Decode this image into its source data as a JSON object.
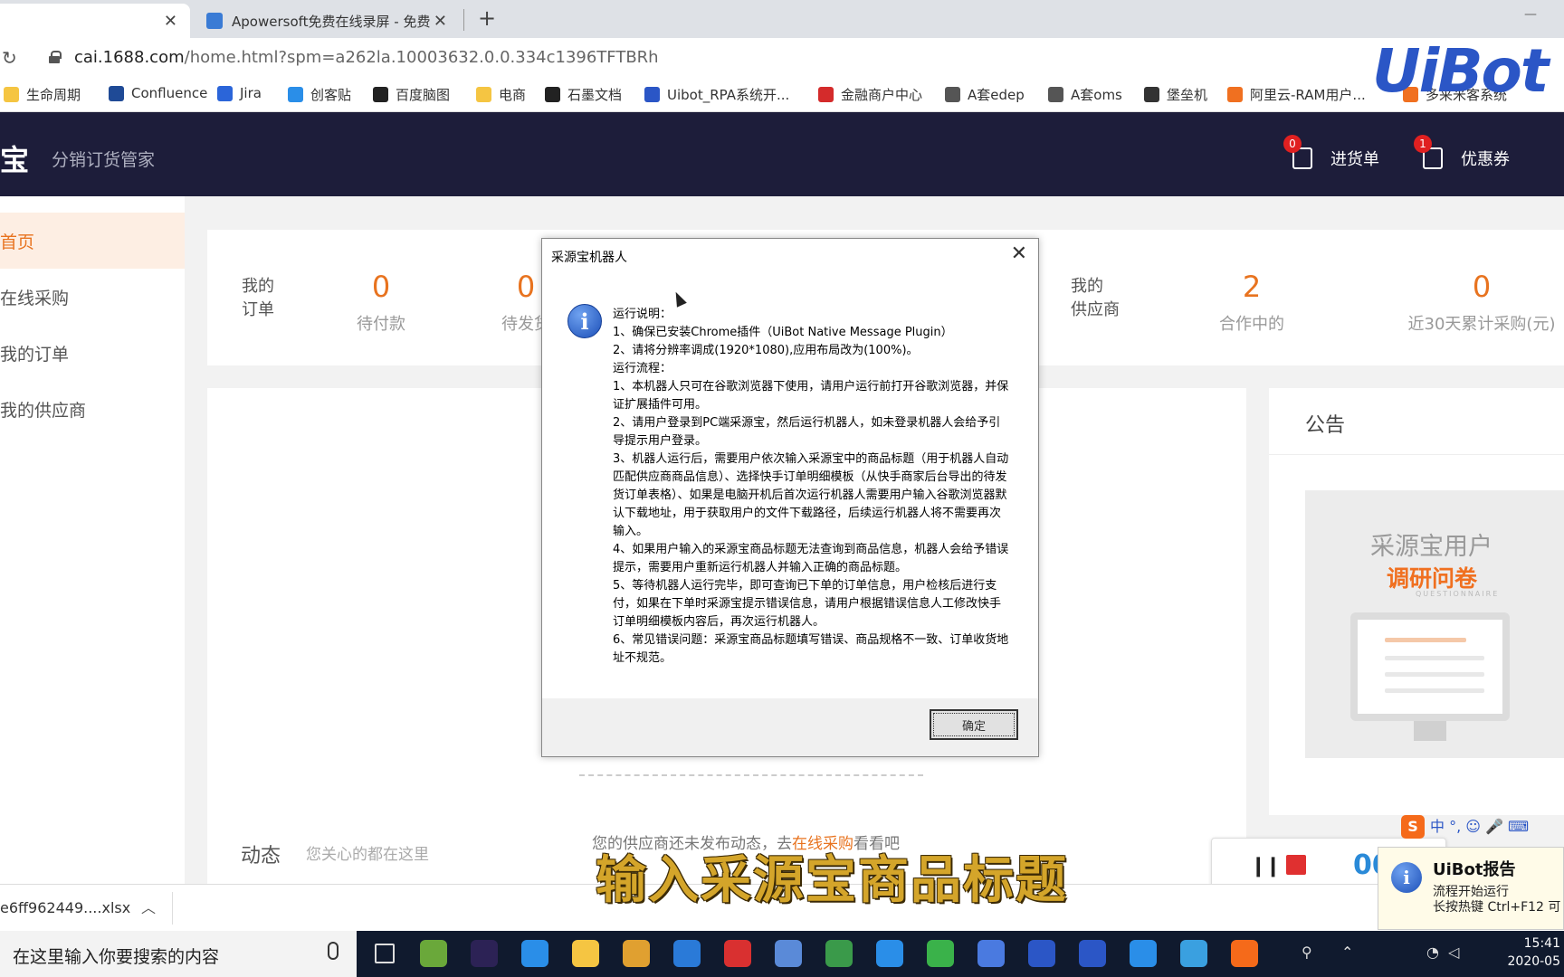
{
  "browser": {
    "tabs": [
      {
        "label": "",
        "active": true
      },
      {
        "label": "Apowersoft免费在线录屏 - 免费",
        "active": false
      }
    ],
    "new_tab": "+",
    "close_glyph": "✕",
    "url_host": "cai.1688.com",
    "url_path": "/home.html?spm=a262la.10003632.0.0.334c1396TFTBRh",
    "bookmarks": [
      {
        "label": "生命周期",
        "icon": "folder-icon",
        "color": "#f5c542"
      },
      {
        "label": "Confluence",
        "icon": "confluence-icon",
        "color": "#1f4a96"
      },
      {
        "label": "Jira",
        "icon": "jira-icon",
        "color": "#2b65d9"
      },
      {
        "label": "创客贴",
        "icon": "chuangketie-icon",
        "color": "#2a8ee8"
      },
      {
        "label": "百度脑图",
        "icon": "baidu-naotu-icon",
        "color": "#222"
      },
      {
        "label": "电商",
        "icon": "folder-icon",
        "color": "#f5c542"
      },
      {
        "label": "石墨文档",
        "icon": "shimo-icon",
        "color": "#222"
      },
      {
        "label": "Uibot_RPA系统开...",
        "icon": "uibot-icon",
        "color": "#2b56c6"
      },
      {
        "label": "金融商户中心",
        "icon": "jd-icon",
        "color": "#d42b2b"
      },
      {
        "label": "A套edep",
        "icon": "globe-icon",
        "color": "#555"
      },
      {
        "label": "A套oms",
        "icon": "globe-icon",
        "color": "#555"
      },
      {
        "label": "堡垒机",
        "icon": "shield-icon",
        "color": "#333"
      },
      {
        "label": "阿里云-RAM用户...",
        "icon": "aliyun-icon",
        "color": "#f07020"
      },
      {
        "label": "多来米客系统",
        "icon": "app-icon",
        "color": "#f07020"
      }
    ],
    "overlay_logo": "UiBot"
  },
  "site": {
    "logo": "宝",
    "subtitle": "分销订货管家",
    "header_buttons": [
      {
        "label": "进货单",
        "badge": "0",
        "icon": "purchase-list-icon"
      },
      {
        "label": "优惠券",
        "badge": "1",
        "icon": "coupon-icon"
      }
    ],
    "sidebar": [
      {
        "label": "首页",
        "active": true
      },
      {
        "label": "在线采购",
        "active": false
      },
      {
        "label": "我的订单",
        "active": false
      },
      {
        "label": "我的供应商",
        "active": false
      }
    ],
    "orders": {
      "label": "我的\n订单",
      "stats": [
        {
          "value": "0",
          "label": "待付款"
        },
        {
          "value": "0",
          "label": "待发货"
        }
      ]
    },
    "suppliers": {
      "label": "我的\n供应商",
      "stats": [
        {
          "value": "2",
          "label": "合作中的"
        },
        {
          "value": "0",
          "label": "近30天累计采购(元)"
        }
      ]
    },
    "notice": {
      "title": "公告",
      "survey_line1": "采源宝用户",
      "survey_line2": "调研问卷",
      "survey_line3": "QUESTIONNAIRE"
    },
    "dynamics": {
      "title": "动态",
      "subtitle": "您关心的都在这里",
      "empty_prefix": "您的供应商还未发布动态，去",
      "empty_link": "在线采购",
      "empty_suffix": "看看吧"
    }
  },
  "dialog": {
    "title": "采源宝机器人",
    "lines": [
      "运行说明：",
      "1、确保已安装Chrome插件（UiBot Native Message Plugin）",
      "2、请将分辨率调成(1920*1080),应用布局改为(100%)。",
      "运行流程：",
      " 1、本机器人只可在谷歌浏览器下使用，请用户运行前打开谷歌浏览器，并保证扩展插件可用。",
      "2、请用户登录到PC端采源宝，然后运行机器人，如未登录机器人会给予引导提示用户登录。",
      "3、机器人运行后，需要用户依次输入采源宝中的商品标题（用于机器人自动匹配供应商商品信息）、选择快手订单明细模板（从快手商家后台导出的待发货订单表格）、如果是电脑开机后首次运行机器人需要用户输入谷歌浏览器默认下载地址，用于获取用户的文件下载路径，后续运行机器人将不需要再次输入。",
      "4、如果用户输入的采源宝商品标题无法查询到商品信息，机器人会给予错误提示，需要用户重新运行机器人并输入正确的商品标题。",
      "5、等待机器人运行完毕，即可查询已下单的订单信息，用户检核后进行支付，如果在下单时采源宝提示错误信息，请用户根据错误信息人工修改快手订单明细模板内容后，再次运行机器人。",
      "6、常见错误问题：采源宝商品标题填写错误、商品规格不一致、订单收货地址不规范。"
    ],
    "ok_label": "确定",
    "close_glyph": "✕"
  },
  "caption": "输入采源宝商品标题",
  "recorder": {
    "time": "00"
  },
  "ime": {
    "logo": "S",
    "text": "中 °, ☺ 🎤 ⌨"
  },
  "notification": {
    "title": "UiBot报告",
    "line1": "流程开始运行",
    "line2": "长按热键 Ctrl+F12 可"
  },
  "download": {
    "file": "e6ff962449....xlsx",
    "chevron": "︿"
  },
  "taskbar": {
    "search_placeholder": "在这里输入你要搜索的内容",
    "time": "15:41",
    "date": "2020-05",
    "icons": [
      {
        "name": "task-view-icon",
        "color": "#101a2e"
      },
      {
        "name": "notepad-icon",
        "color": "#6aa83a"
      },
      {
        "name": "eclipse-icon",
        "color": "#2c2255"
      },
      {
        "name": "feather-icon",
        "color": "#2a8ee8"
      },
      {
        "name": "file-explorer-icon",
        "color": "#f5c542"
      },
      {
        "name": "book-icon",
        "color": "#e0a030"
      },
      {
        "name": "edge-icon",
        "color": "#2a7ad8"
      },
      {
        "name": "app-red-icon",
        "color": "#d93030"
      },
      {
        "name": "computer-icon",
        "color": "#5a8ad8"
      },
      {
        "name": "chrome-icon",
        "color": "#3a9a4a"
      },
      {
        "name": "feishu-icon",
        "color": "#2a8ee8"
      },
      {
        "name": "wechat-icon",
        "color": "#3ab24a"
      },
      {
        "name": "bot-icon",
        "color": "#4a7ae0"
      },
      {
        "name": "uibot-creator-icon",
        "color": "#2b56c6"
      },
      {
        "name": "uibot-worker-icon",
        "color": "#2b56c6"
      },
      {
        "name": "wps-icon",
        "color": "#2a8ee8"
      },
      {
        "name": "recorder-icon",
        "color": "#3aa0e0"
      },
      {
        "name": "sogou-icon",
        "color": "#f56a1a"
      }
    ]
  }
}
